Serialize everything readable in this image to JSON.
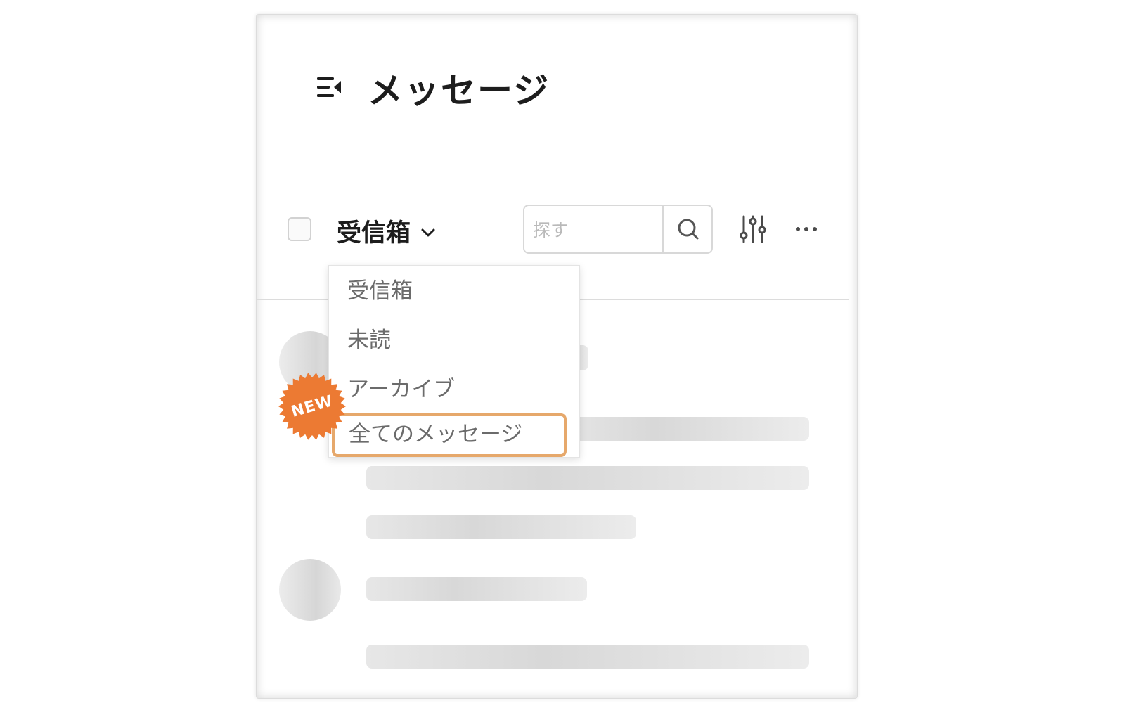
{
  "header": {
    "title": "メッセージ"
  },
  "toolbar": {
    "folder_label": "受信箱",
    "search_placeholder": "探す"
  },
  "dropdown": {
    "items": [
      "受信箱",
      "未読",
      "アーカイブ",
      "全てのメッセージ"
    ],
    "highlighted_index": 3
  },
  "badge": {
    "label": "NEW",
    "color": "#ec7a33"
  },
  "colors": {
    "highlight_border": "#e6a86b",
    "badge": "#ec7a33"
  },
  "icons": {
    "menu": "collapse-menu-icon",
    "chevron": "chevron-down-icon",
    "search": "search-icon",
    "filter": "filter-sliders-icon",
    "more": "more-horizontal-icon"
  }
}
